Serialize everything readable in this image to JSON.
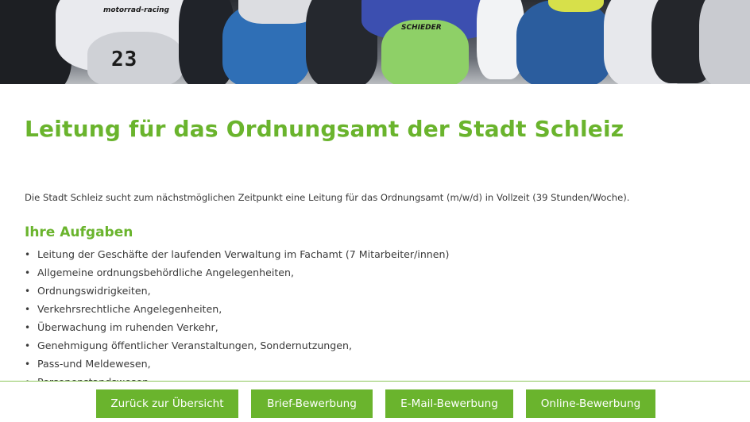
{
  "hero": {
    "bike_number": "23",
    "sponsor_left": "motorrad-racing",
    "sponsor_mid": "SCHIEDER"
  },
  "job": {
    "title": "Leitung für das Ordnungsamt der Stadt Schleiz",
    "intro": "Die Stadt Schleiz sucht zum nächstmöglichen Zeitpunkt eine Leitung für das Ordnungsamt (m/w/d) in Vollzeit (39 Stunden/Woche).",
    "tasks_heading": "Ihre Aufgaben",
    "tasks": [
      "Leitung der Geschäfte der laufenden Verwaltung im Fachamt (7 Mitarbeiter/innen)",
      "Allgemeine ordnungsbehördliche Angelegenheiten,",
      "Ordnungswidrigkeiten,",
      "Verkehrsrechtliche Angelegenheiten,",
      "Überwachung im ruhenden Verkehr,",
      "Genehmigung öffentlicher Veranstaltungen, Sondernutzungen,",
      "Pass-und Meldewesen,",
      "Personenstandswesen,"
    ],
    "bullet": "•"
  },
  "actions": {
    "back": "Zurück zur Übersicht",
    "letter": "Brief-Bewerbung",
    "email": "E-Mail-Bewerbung",
    "online": "Online-Bewerbung"
  },
  "colors": {
    "accent": "#6ab42d",
    "text": "#3a3a3a"
  }
}
